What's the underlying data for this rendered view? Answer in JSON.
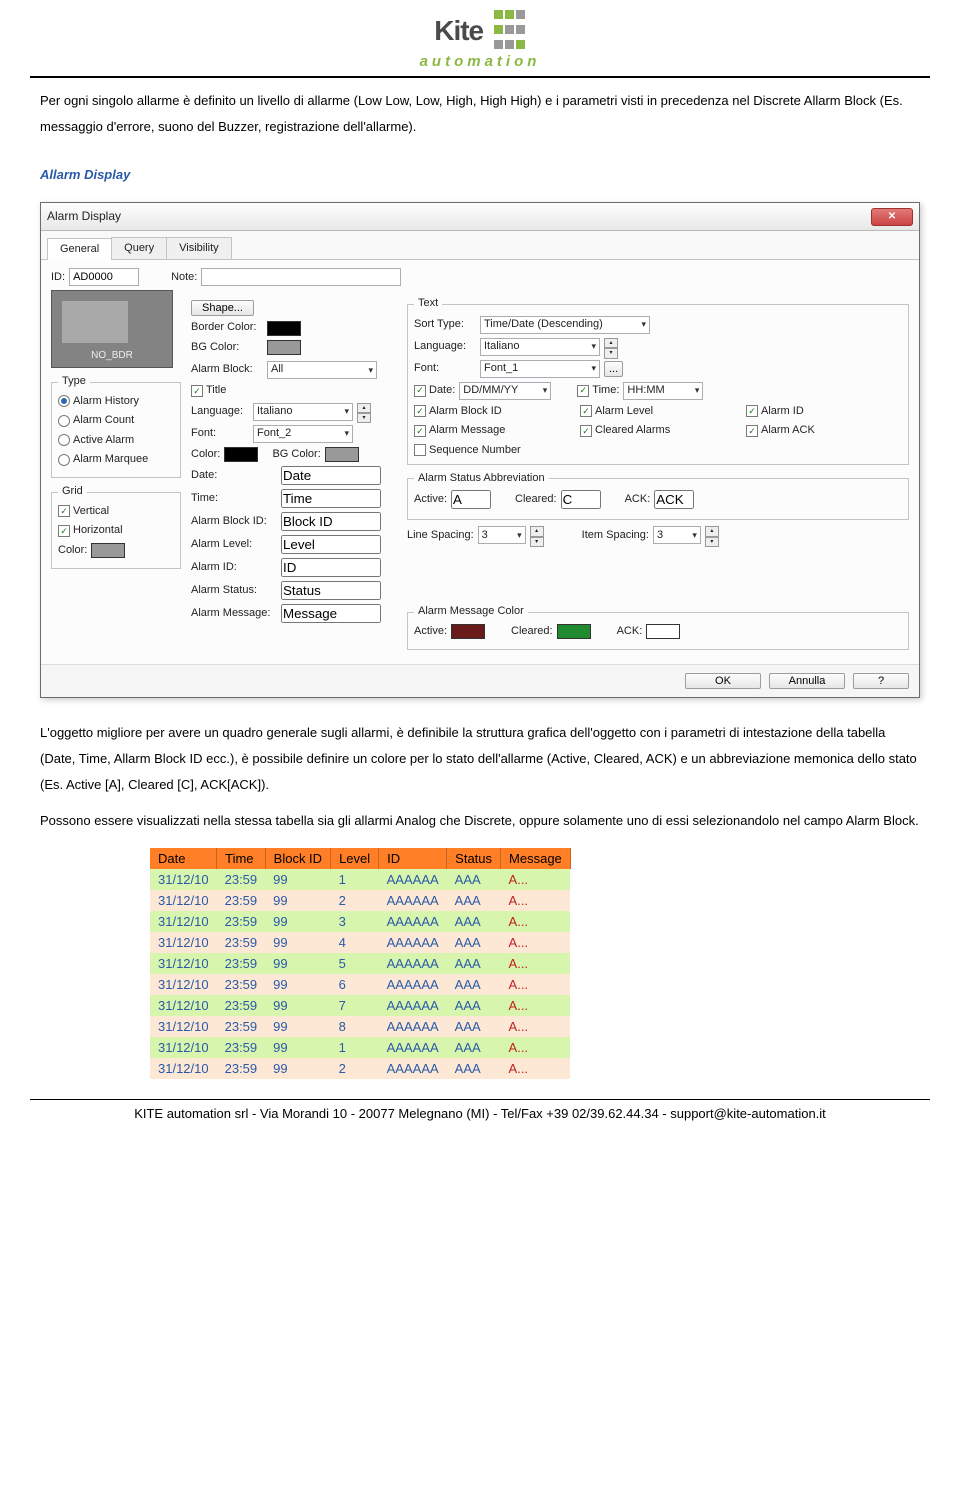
{
  "logo": {
    "name": "Kite",
    "sub": "automation"
  },
  "para1": "Per ogni singolo allarme è definito un livello di allarme (Low Low, Low, High, High High) e i parametri visti in precedenza nel Discrete Allarm Block (Es. messaggio d'errore, suono del Buzzer, registrazione dell'allarme).",
  "section_title": "Allarm Display",
  "dialog": {
    "title": "Alarm Display",
    "tabs": [
      "General",
      "Query",
      "Visibility"
    ],
    "id_label": "ID:",
    "id_value": "AD0000",
    "note_label": "Note:",
    "note_value": "",
    "preview_label": "NO_BDR",
    "shape_btn": "Shape...",
    "border_color_label": "Border Color:",
    "bg_color_label": "BG Color:",
    "type": {
      "legend": "Type",
      "options": [
        "Alarm History",
        "Alarm Count",
        "Active Alarm",
        "Alarm Marquee"
      ],
      "selected": 0
    },
    "grid": {
      "legend": "Grid",
      "vertical": "Vertical",
      "horizontal": "Horizontal",
      "color_label": "Color:"
    },
    "middle": {
      "alarm_block_label": "Alarm Block:",
      "alarm_block_value": "All",
      "title_chk": "Title",
      "language_label": "Language:",
      "language_value": "Italiano",
      "font_label": "Font:",
      "font_value": "Font_2",
      "color_label": "Color:",
      "bg_color_label": "BG Color:",
      "date_label": "Date:",
      "date_value": "Date",
      "time_label": "Time:",
      "time_value": "Time",
      "block_id_label": "Alarm Block ID:",
      "block_id_value": "Block ID",
      "level_label": "Alarm Level:",
      "level_value": "Level",
      "alarm_id_label": "Alarm ID:",
      "alarm_id_value": "ID",
      "status_label": "Alarm Status:",
      "status_value": "Status",
      "message_label": "Alarm Message:",
      "message_value": "Message"
    },
    "right": {
      "text_legend": "Text",
      "sort_label": "Sort Type:",
      "sort_value": "Time/Date (Descending)",
      "language_label": "Language:",
      "language_value": "Italiano",
      "font_label": "Font:",
      "font_value": "Font_1",
      "date_chk": "Date:",
      "date_value": "DD/MM/YY",
      "time_chk": "Time:",
      "time_value": "HH:MM",
      "checks": [
        "Alarm Block ID",
        "Alarm Level",
        "Alarm ID",
        "Alarm Message",
        "Cleared Alarms",
        "Alarm ACK",
        "Sequence Number"
      ],
      "checks_state": [
        true,
        true,
        true,
        true,
        true,
        true,
        false
      ],
      "abbrev_legend": "Alarm Status Abbreviation",
      "active_label": "Active:",
      "active_value": "A",
      "cleared_label": "Cleared:",
      "cleared_value": "C",
      "ack_label": "ACK:",
      "ack_value": "ACK",
      "line_spacing_label": "Line Spacing:",
      "line_spacing_value": "3",
      "item_spacing_label": "Item Spacing:",
      "item_spacing_value": "3",
      "msg_color_legend": "Alarm Message Color",
      "msg_active": "Active:",
      "msg_cleared": "Cleared:",
      "msg_ack": "ACK:"
    },
    "footer": {
      "ok": "OK",
      "cancel": "Annulla",
      "help": "?"
    }
  },
  "para2": "L'oggetto migliore per avere un quadro generale sugli allarmi, è definibile la struttura grafica dell'oggetto con i parametri di intestazione della tabella (Date, Time, Allarm Block ID ecc.), è possibile definire un colore per lo stato dell'allarme (Active, Cleared, ACK) e un abbreviazione memonica dello stato (Es. Active [A], Cleared [C], ACK[ACK]).",
  "para3": "Possono essere visualizzati nella stessa tabella sia gli allarmi Analog che Discrete, oppure solamente uno di essi selezionandolo nel campo Alarm Block.",
  "table": {
    "headers": [
      "Date",
      "Time",
      "Block ID",
      "Level",
      "ID",
      "Status",
      "Message"
    ],
    "rows": [
      [
        "31/12/10",
        "23:59",
        "99",
        "1",
        "AAAAAA",
        "AAA",
        "A..."
      ],
      [
        "31/12/10",
        "23:59",
        "99",
        "2",
        "AAAAAA",
        "AAA",
        "A..."
      ],
      [
        "31/12/10",
        "23:59",
        "99",
        "3",
        "AAAAAA",
        "AAA",
        "A..."
      ],
      [
        "31/12/10",
        "23:59",
        "99",
        "4",
        "AAAAAA",
        "AAA",
        "A..."
      ],
      [
        "31/12/10",
        "23:59",
        "99",
        "5",
        "AAAAAA",
        "AAA",
        "A..."
      ],
      [
        "31/12/10",
        "23:59",
        "99",
        "6",
        "AAAAAA",
        "AAA",
        "A..."
      ],
      [
        "31/12/10",
        "23:59",
        "99",
        "7",
        "AAAAAA",
        "AAA",
        "A..."
      ],
      [
        "31/12/10",
        "23:59",
        "99",
        "8",
        "AAAAAA",
        "AAA",
        "A..."
      ],
      [
        "31/12/10",
        "23:59",
        "99",
        "1",
        "AAAAAA",
        "AAA",
        "A..."
      ],
      [
        "31/12/10",
        "23:59",
        "99",
        "2",
        "AAAAAA",
        "AAA",
        "A..."
      ]
    ]
  },
  "footer_text": "KITE automation srl - Via Morandi 10 - 20077 Melegnano (MI) - Tel/Fax +39 02/39.62.44.34 - support@kite-automation.it"
}
